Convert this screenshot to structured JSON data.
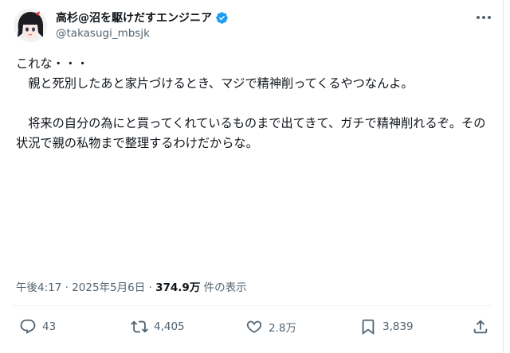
{
  "author": {
    "display_name": "高杉@沼を駆けだすエンジニア",
    "handle": "@takasugi_mbsjk",
    "verified": true,
    "avatar_icon": "avatar-anime-girl-icon"
  },
  "tweet": {
    "text": "これな・・・\n　親と死別したあと家片づけるとき、マジで精神削ってくるやつなんよ。\n\n　将来の自分の為にと買ってくれているものまで出てきて、ガチで精神削れるぞ。その状況で親の私物まで整理するわけだからな。"
  },
  "meta": {
    "time": "午後4:17",
    "separator1": " · ",
    "date": "2025年5月6日",
    "separator2": " · ",
    "views_count": "374.9万",
    "views_label": " 件の表示"
  },
  "actions": {
    "replies": "43",
    "retweets": "4,405",
    "likes": "2.8万",
    "bookmarks": "3,839"
  },
  "colors": {
    "text": "#0f1419",
    "secondary": "#536471",
    "verified": "#1d9bf0",
    "divider": "#eff3f4"
  }
}
